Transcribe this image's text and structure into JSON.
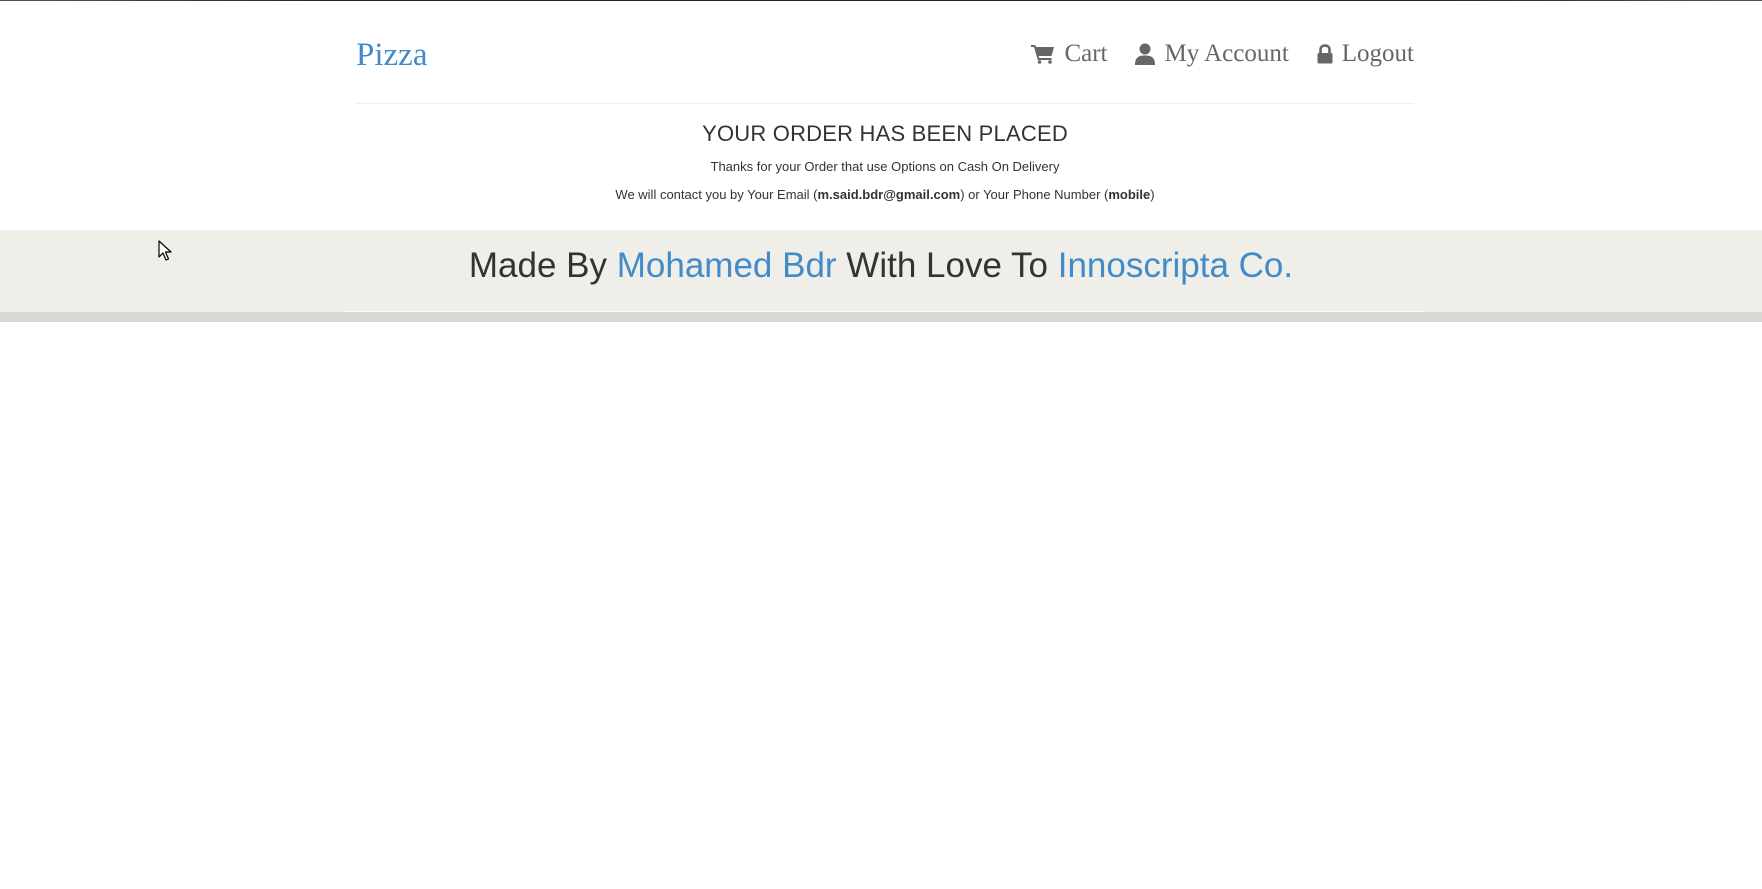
{
  "header": {
    "brand": "Pizza",
    "nav": [
      {
        "label": "Cart",
        "icon": "cart-icon"
      },
      {
        "label": "My Account",
        "icon": "user-icon"
      },
      {
        "label": "Logout",
        "icon": "lock-icon"
      }
    ]
  },
  "order": {
    "title": "YOUR ORDER HAS BEEN PLACED",
    "thanks": "Thanks for your Order that use Options on Cash On Delivery",
    "contact_prefix": "We will contact you by Your Email (",
    "email": "m.said.bdr@gmail.com",
    "contact_middle": ") or Your Phone Number (",
    "phone": "mobile",
    "contact_suffix": ")"
  },
  "footer": {
    "made_by": "Made By",
    "author": "Mohamed Bdr",
    "with_love": "With Love To",
    "company": "Innoscripta Co."
  },
  "colors": {
    "link": "#428bca",
    "text": "#333333",
    "nav_text": "#666666",
    "footer_bg": "#efeee9"
  }
}
